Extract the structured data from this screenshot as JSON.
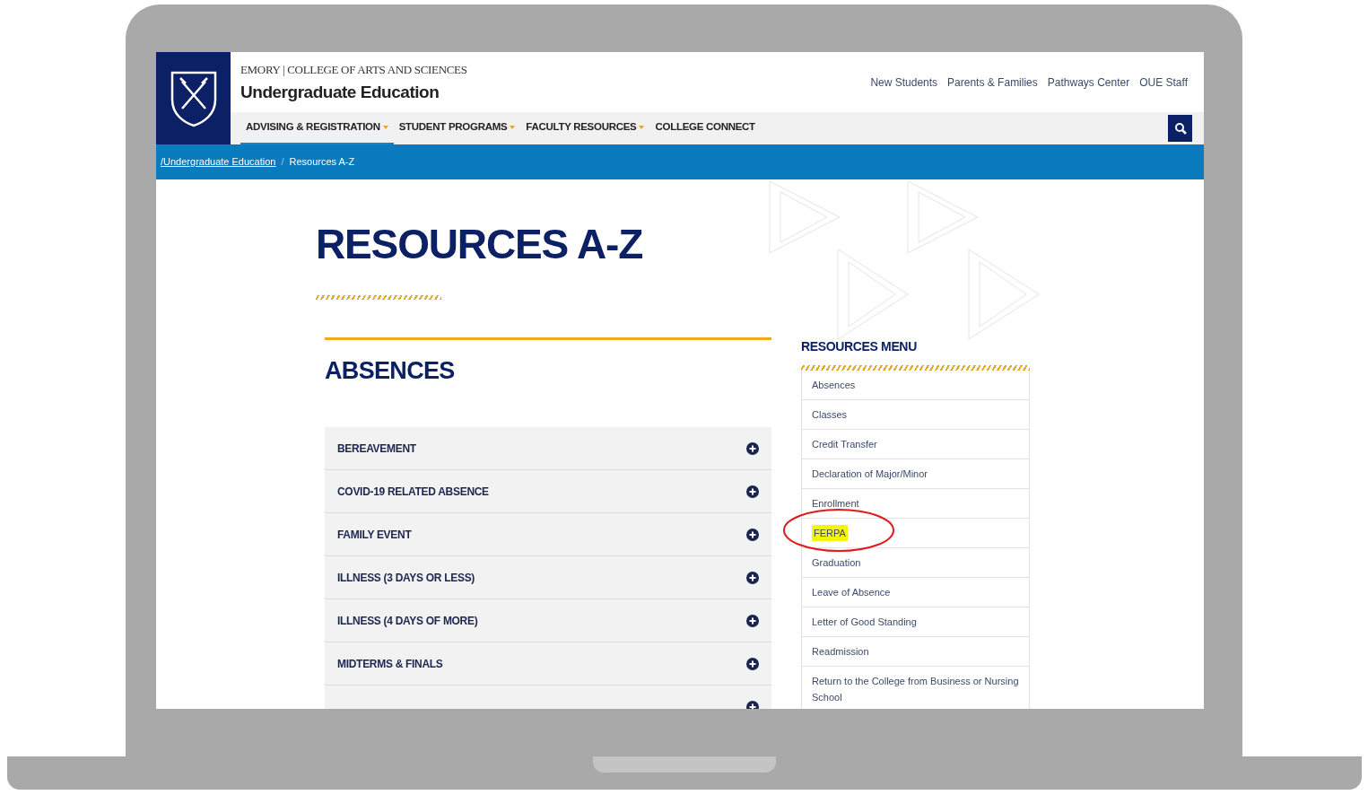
{
  "header": {
    "college": "EMORY | COLLEGE OF ARTS AND SCIENCES",
    "site_title": "Undergraduate Education",
    "utility_links": [
      "New Students",
      "Parents & Families",
      "Pathways Center",
      "OUE Staff"
    ]
  },
  "nav": [
    {
      "label": "ADVISING & REGISTRATION",
      "selected": true,
      "dropdown": true
    },
    {
      "label": "STUDENT PROGRAMS",
      "selected": false,
      "dropdown": true
    },
    {
      "label": "FACULTY RESOURCES",
      "selected": false,
      "dropdown": true
    },
    {
      "label": "COLLEGE CONNECT",
      "selected": false,
      "dropdown": false
    }
  ],
  "breadcrumb": [
    {
      "label": "/Undergraduate Education",
      "link": true
    },
    {
      "label": "Resources A-Z",
      "link": false
    }
  ],
  "breadcrumb_separator": "/",
  "page_title": "RESOURCES A-Z",
  "section": {
    "title": "ABSENCES",
    "items": [
      {
        "kind": "row",
        "label": "BEREAVEMENT"
      },
      {
        "kind": "row",
        "label": "COVID-19 RELATED ABSENCE"
      },
      {
        "kind": "row",
        "label": "FAMILY EVENT"
      },
      {
        "kind": "row",
        "label": "ILLNESS (3 DAYS OR LESS)"
      },
      {
        "kind": "row",
        "label": "ILLNESS (4 DAYS OF MORE)"
      },
      {
        "kind": "row",
        "label": "MIDTERMS & FINALS"
      },
      {
        "kind": "partial"
      }
    ]
  },
  "resources_menu": {
    "title": "RESOURCES MENU",
    "items": [
      {
        "label": "Absences",
        "highlighted": false
      },
      {
        "label": "Classes",
        "highlighted": false
      },
      {
        "label": "Credit Transfer",
        "highlighted": false
      },
      {
        "label": "Declaration of Major/Minor",
        "highlighted": false
      },
      {
        "label": "Enrollment",
        "highlighted": false
      },
      {
        "label": "FERPA",
        "highlighted": true
      },
      {
        "label": "Graduation",
        "highlighted": false
      },
      {
        "label": "Leave of Absence",
        "highlighted": false
      },
      {
        "label": "Letter of Good Standing",
        "highlighted": false
      },
      {
        "label": "Readmission",
        "highlighted": false
      },
      {
        "label": "Return to the College from Business or Nursing School",
        "highlighted": false
      }
    ]
  }
}
